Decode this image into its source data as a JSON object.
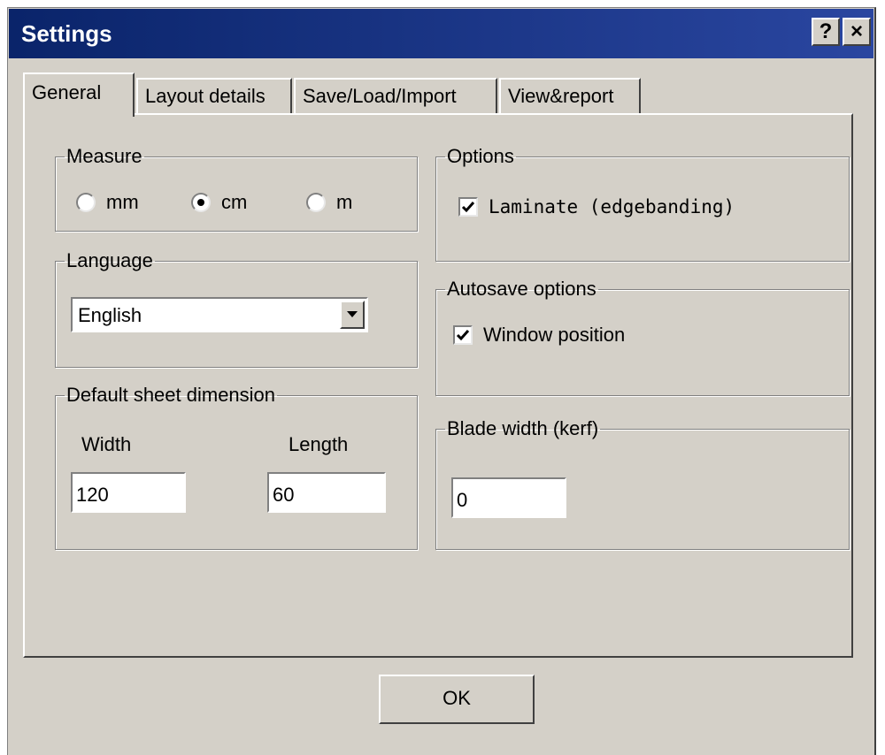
{
  "window": {
    "title": "Settings",
    "help_label": "?",
    "close_label": "×"
  },
  "tabs": [
    {
      "label": "General",
      "active": true
    },
    {
      "label": "Layout details",
      "active": false
    },
    {
      "label": "Save/Load/Import",
      "active": false
    },
    {
      "label": "View&report",
      "active": false
    }
  ],
  "measure": {
    "legend": "Measure",
    "options": [
      {
        "label": "mm",
        "selected": false
      },
      {
        "label": "cm",
        "selected": true
      },
      {
        "label": "m",
        "selected": false
      }
    ]
  },
  "options": {
    "legend": "Options",
    "laminate_label": "Laminate (edgebanding)",
    "laminate_checked": true
  },
  "language": {
    "legend": "Language",
    "selected": "English"
  },
  "autosave": {
    "legend": "Autosave options",
    "window_position_label": "Window position",
    "window_position_checked": true
  },
  "sheet": {
    "legend": "Default sheet dimension",
    "width_label": "Width",
    "width_value": "120",
    "length_label": "Length",
    "length_value": "60"
  },
  "blade": {
    "legend": "Blade width (kerf)",
    "value": "0"
  },
  "footer": {
    "ok_label": "OK"
  },
  "icons": {
    "check": "check-mark-icon",
    "dropdown": "triangle-down-icon"
  }
}
